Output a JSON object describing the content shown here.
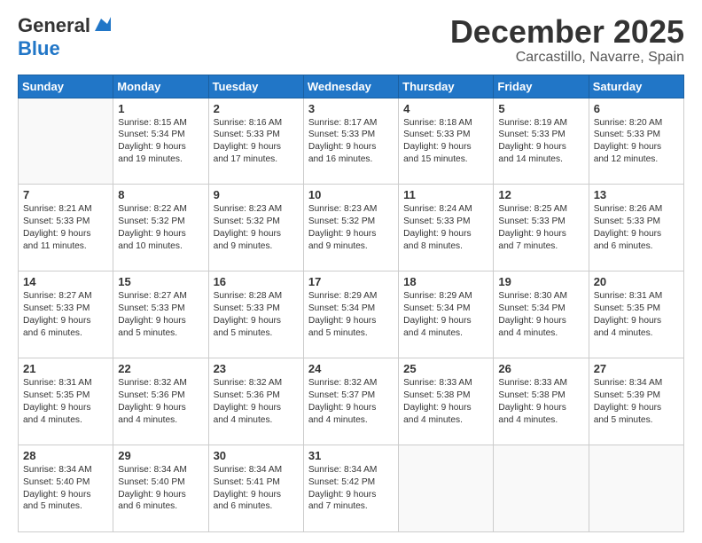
{
  "header": {
    "logo_general": "General",
    "logo_blue": "Blue",
    "title": "December 2025",
    "location": "Carcastillo, Navarre, Spain"
  },
  "days_of_week": [
    "Sunday",
    "Monday",
    "Tuesday",
    "Wednesday",
    "Thursday",
    "Friday",
    "Saturday"
  ],
  "weeks": [
    [
      {
        "day": "",
        "info": ""
      },
      {
        "day": "1",
        "info": "Sunrise: 8:15 AM\nSunset: 5:34 PM\nDaylight: 9 hours\nand 19 minutes."
      },
      {
        "day": "2",
        "info": "Sunrise: 8:16 AM\nSunset: 5:33 PM\nDaylight: 9 hours\nand 17 minutes."
      },
      {
        "day": "3",
        "info": "Sunrise: 8:17 AM\nSunset: 5:33 PM\nDaylight: 9 hours\nand 16 minutes."
      },
      {
        "day": "4",
        "info": "Sunrise: 8:18 AM\nSunset: 5:33 PM\nDaylight: 9 hours\nand 15 minutes."
      },
      {
        "day": "5",
        "info": "Sunrise: 8:19 AM\nSunset: 5:33 PM\nDaylight: 9 hours\nand 14 minutes."
      },
      {
        "day": "6",
        "info": "Sunrise: 8:20 AM\nSunset: 5:33 PM\nDaylight: 9 hours\nand 12 minutes."
      }
    ],
    [
      {
        "day": "7",
        "info": "Sunrise: 8:21 AM\nSunset: 5:33 PM\nDaylight: 9 hours\nand 11 minutes."
      },
      {
        "day": "8",
        "info": "Sunrise: 8:22 AM\nSunset: 5:32 PM\nDaylight: 9 hours\nand 10 minutes."
      },
      {
        "day": "9",
        "info": "Sunrise: 8:23 AM\nSunset: 5:32 PM\nDaylight: 9 hours\nand 9 minutes."
      },
      {
        "day": "10",
        "info": "Sunrise: 8:23 AM\nSunset: 5:32 PM\nDaylight: 9 hours\nand 9 minutes."
      },
      {
        "day": "11",
        "info": "Sunrise: 8:24 AM\nSunset: 5:33 PM\nDaylight: 9 hours\nand 8 minutes."
      },
      {
        "day": "12",
        "info": "Sunrise: 8:25 AM\nSunset: 5:33 PM\nDaylight: 9 hours\nand 7 minutes."
      },
      {
        "day": "13",
        "info": "Sunrise: 8:26 AM\nSunset: 5:33 PM\nDaylight: 9 hours\nand 6 minutes."
      }
    ],
    [
      {
        "day": "14",
        "info": "Sunrise: 8:27 AM\nSunset: 5:33 PM\nDaylight: 9 hours\nand 6 minutes."
      },
      {
        "day": "15",
        "info": "Sunrise: 8:27 AM\nSunset: 5:33 PM\nDaylight: 9 hours\nand 5 minutes."
      },
      {
        "day": "16",
        "info": "Sunrise: 8:28 AM\nSunset: 5:33 PM\nDaylight: 9 hours\nand 5 minutes."
      },
      {
        "day": "17",
        "info": "Sunrise: 8:29 AM\nSunset: 5:34 PM\nDaylight: 9 hours\nand 5 minutes."
      },
      {
        "day": "18",
        "info": "Sunrise: 8:29 AM\nSunset: 5:34 PM\nDaylight: 9 hours\nand 4 minutes."
      },
      {
        "day": "19",
        "info": "Sunrise: 8:30 AM\nSunset: 5:34 PM\nDaylight: 9 hours\nand 4 minutes."
      },
      {
        "day": "20",
        "info": "Sunrise: 8:31 AM\nSunset: 5:35 PM\nDaylight: 9 hours\nand 4 minutes."
      }
    ],
    [
      {
        "day": "21",
        "info": "Sunrise: 8:31 AM\nSunset: 5:35 PM\nDaylight: 9 hours\nand 4 minutes."
      },
      {
        "day": "22",
        "info": "Sunrise: 8:32 AM\nSunset: 5:36 PM\nDaylight: 9 hours\nand 4 minutes."
      },
      {
        "day": "23",
        "info": "Sunrise: 8:32 AM\nSunset: 5:36 PM\nDaylight: 9 hours\nand 4 minutes."
      },
      {
        "day": "24",
        "info": "Sunrise: 8:32 AM\nSunset: 5:37 PM\nDaylight: 9 hours\nand 4 minutes."
      },
      {
        "day": "25",
        "info": "Sunrise: 8:33 AM\nSunset: 5:38 PM\nDaylight: 9 hours\nand 4 minutes."
      },
      {
        "day": "26",
        "info": "Sunrise: 8:33 AM\nSunset: 5:38 PM\nDaylight: 9 hours\nand 4 minutes."
      },
      {
        "day": "27",
        "info": "Sunrise: 8:34 AM\nSunset: 5:39 PM\nDaylight: 9 hours\nand 5 minutes."
      }
    ],
    [
      {
        "day": "28",
        "info": "Sunrise: 8:34 AM\nSunset: 5:40 PM\nDaylight: 9 hours\nand 5 minutes."
      },
      {
        "day": "29",
        "info": "Sunrise: 8:34 AM\nSunset: 5:40 PM\nDaylight: 9 hours\nand 6 minutes."
      },
      {
        "day": "30",
        "info": "Sunrise: 8:34 AM\nSunset: 5:41 PM\nDaylight: 9 hours\nand 6 minutes."
      },
      {
        "day": "31",
        "info": "Sunrise: 8:34 AM\nSunset: 5:42 PM\nDaylight: 9 hours\nand 7 minutes."
      },
      {
        "day": "",
        "info": ""
      },
      {
        "day": "",
        "info": ""
      },
      {
        "day": "",
        "info": ""
      }
    ]
  ]
}
